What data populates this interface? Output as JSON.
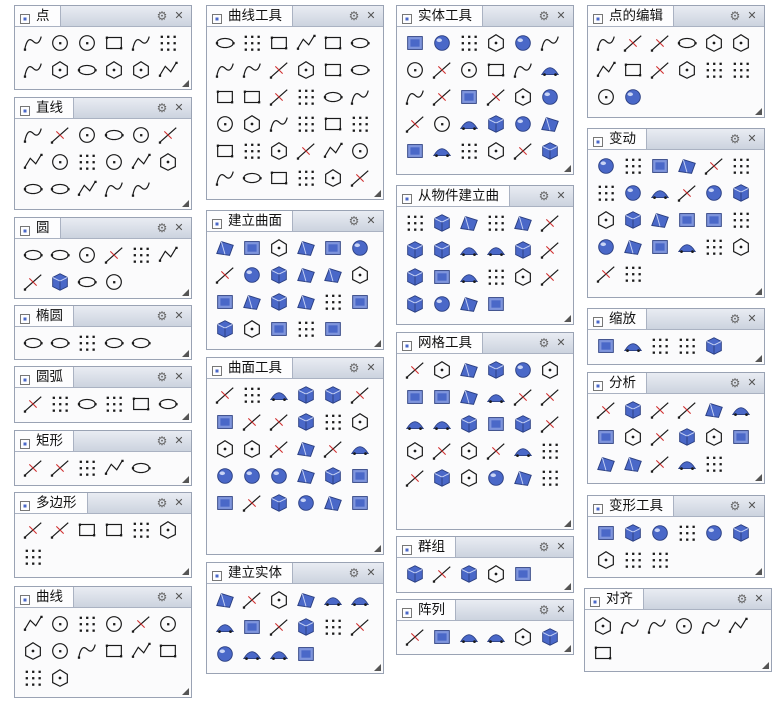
{
  "colors": {
    "panel_bg": "#fbfbfc",
    "titlebar": "#d9dde7",
    "border": "#9aa3b4",
    "icon_blue": "#4a68c8",
    "icon_dark": "#1a1a1a"
  },
  "panels": [
    {
      "id": "point",
      "title": "点",
      "icon": "point-panel-icon",
      "cols": 6,
      "buttons": [
        "single-point",
        "multiple-points",
        "point-cloud",
        "points-on-curve",
        "divide-curve",
        "closest-point",
        "point-grid",
        "points-from-grid",
        "dense-grid",
        "random-points",
        "extract-points",
        "curve-points"
      ]
    },
    {
      "id": "curve-tools",
      "title": "曲线工具",
      "icon": "curve-tools-panel-icon",
      "cols": 6,
      "buttons": [
        "fillet-curve",
        "chamfer-curve",
        "blend-curve",
        "match-curve",
        "offset-curve",
        "extend-curve",
        "control-points-on",
        "curve-edit-point",
        "arc-blend",
        "rebuild-curve",
        "project-curve",
        "dash-curve",
        "fit-curve",
        "rotate-curve",
        "helix",
        "dual-curve",
        "person-edit",
        "person-work",
        "fit-label",
        "deg-label",
        "fair-label",
        "point-array",
        "polygon-edit",
        "insert-knot",
        "crv-a",
        "crv-b",
        "crv-c",
        "crv-d",
        "crv-e",
        "crv-f",
        "crv-g",
        "crv-h",
        "crv-i",
        "crv-j",
        "crv-k",
        "crv-l"
      ]
    },
    {
      "id": "solid-tools",
      "title": "实体工具",
      "icon": "solid-tools-panel-icon",
      "cols": 6,
      "buttons": [
        "boolean-union",
        "boolean-difference",
        "boolean-intersection",
        "boolean-split",
        "cap-holes",
        "extract-surface",
        "fillet-edge",
        "chamfer-edge",
        "shell",
        "extrude-face",
        "move-face",
        "solid-points",
        "move-edge",
        "split-face",
        "box-edit",
        "box-merge",
        "box-face",
        "box-cut",
        "shift-face",
        "merge-face",
        "stack-solids",
        "box-a",
        "box-b",
        "box-c",
        "box-d",
        "box-e",
        "box-f",
        "box-g",
        "box-h",
        "box-i",
        "hole-a",
        "hole-b",
        "hole-c",
        "hole-d",
        "hole-e",
        "hole-f"
      ]
    },
    {
      "id": "point-edit",
      "title": "点的编辑",
      "icon": "point-edit-panel-icon",
      "cols": 6,
      "buttons": [
        "points-on",
        "edit-points",
        "hide-points",
        "insert-point",
        "remove-point",
        "line-point",
        "move-uvn",
        "nudge",
        "smooth-curve",
        "set-pt",
        "drag-points",
        "sphere-pt",
        "green-handle",
        "box-handle"
      ]
    },
    {
      "id": "line",
      "title": "直线",
      "icon": "line-panel-icon",
      "cols": 6,
      "buttons": [
        "line-single",
        "polyline",
        "line-segment",
        "tangent-line",
        "line-angle",
        "line-bisector",
        "line-vertical",
        "line-from-midpoint",
        "line-offset",
        "line-normal",
        "line-perpendicular",
        "line-mid",
        "line-3d",
        "line-dashed",
        "line-polygon",
        "line-pentagon",
        "line-grid-sphere"
      ]
    },
    {
      "id": "circle",
      "title": "圆",
      "icon": "circle-panel-icon",
      "cols": 6,
      "buttons": [
        "circle-center",
        "circle-diameter",
        "circle-3pt",
        "circle-tangent",
        "circle-deformable",
        "circle-basic",
        "circle-tan-a",
        "circle-tan-b",
        "circle-fit",
        "circle-points"
      ]
    },
    {
      "id": "ellipse",
      "title": "椭圆",
      "icon": "ellipse-panel-icon",
      "cols": 6,
      "buttons": [
        "ellipse-center",
        "ellipse-diameter",
        "ellipse-foci",
        "ellipse-corner",
        "ellipse-around"
      ]
    },
    {
      "id": "arc",
      "title": "圆弧",
      "icon": "arc-panel-icon",
      "cols": 6,
      "buttons": [
        "arc-center",
        "arc-3pt",
        "arc-tangent",
        "arc-direction",
        "arc-extend",
        "more-arrows"
      ]
    },
    {
      "id": "rect",
      "title": "矩形",
      "icon": "rect-panel-icon",
      "cols": 6,
      "buttons": [
        "rect-corner",
        "rect-center",
        "rect-3pt",
        "rect-vertical",
        "rect-rounded"
      ]
    },
    {
      "id": "polygon",
      "title": "多边形",
      "icon": "polygon-panel-icon",
      "cols": 6,
      "buttons": [
        "polygon-center",
        "polygon-edge",
        "polygon-star",
        "polygon-sq-a",
        "polygon-sq-b",
        "polygon-sq-c",
        "star-shape"
      ]
    },
    {
      "id": "curve",
      "title": "曲线",
      "icon": "curve-panel-icon",
      "cols": 6,
      "buttons": [
        "curve-control",
        "curve-interp",
        "curve-handle",
        "curve-sketch",
        "curve-conic",
        "curve-helix",
        "curve-spiral",
        "curve-free",
        "curve-corner",
        "curve-blend",
        "curve-freehand",
        "curve-a",
        "curve-b",
        "curve-c"
      ]
    },
    {
      "id": "surface",
      "title": "建立曲面",
      "icon": "surface-panel-icon",
      "cols": 6,
      "buttons": [
        "srf-corner",
        "srf-patch",
        "srf-loft",
        "srf-sweep1",
        "srf-sweep2",
        "srf-network",
        "srf-plane",
        "srf-rect",
        "srf-extrude",
        "srf-revolve",
        "srf-edge",
        "srf-heightfield",
        "srf-cylinder",
        "srf-bulge",
        "srf-cone",
        "srf-tilt",
        "srf-cut",
        "srf-point",
        "srf-rail-1-2",
        "srf-fold",
        "srf-drape",
        "srf-heat",
        "srf-grid"
      ]
    },
    {
      "id": "from-object",
      "title": "从物件建立曲",
      "icon": "from-object-panel-icon",
      "cols": 6,
      "buttons": [
        "obj-contour",
        "obj-section",
        "obj-intersect",
        "obj-silhouette",
        "obj-wire",
        "obj-dup-border",
        "obj-dup-edge",
        "obj-offset",
        "obj-project",
        "obj-extract",
        "obj-dup-mesh",
        "obj-dots",
        "obj-points",
        "obj-unroll",
        "obj-a",
        "obj-b",
        "obj-c",
        "obj-d",
        "obj-e",
        "obj-f",
        "obj-g",
        "obj-h"
      ]
    },
    {
      "id": "transform",
      "title": "变动",
      "icon": "transform-panel-icon",
      "cols": 6,
      "buttons": [
        "tr-move",
        "tr-copy",
        "tr-rotate",
        "tr-scale",
        "tr-mirror",
        "tr-orient",
        "tr-align",
        "tr-array",
        "tr-arrange",
        "tr-twist",
        "tr-bend",
        "tr-taper",
        "tr-flow",
        "tr-splop",
        "tr-array-polar",
        "tr-array-curve",
        "tr-array-srf",
        "tr-person",
        "tr-a",
        "tr-b",
        "tr-c",
        "tr-d",
        "tr-e",
        "tr-f",
        "tr-g",
        "tr-red-arrow"
      ]
    },
    {
      "id": "surface-tools",
      "title": "曲面工具",
      "icon": "surface-tools-panel-icon",
      "cols": 6,
      "buttons": [
        "st-fillet",
        "st-chamfer",
        "st-blend",
        "st-match",
        "st-offset",
        "st-extend",
        "st-merge",
        "st-join",
        "st-trim",
        "st-untrim",
        "st-split",
        "st-rebuild",
        "st-shrink",
        "st-edge-a",
        "st-edge-b",
        "st-person",
        "st-person-b",
        "st-fit",
        "st-deg",
        "st-fair",
        "st-pt",
        "st-edge",
        "st-edge-c",
        "st-flow",
        "st-x",
        "st-x2",
        "st-x3",
        "st-x4",
        "st-x5",
        "st-x6"
      ]
    },
    {
      "id": "mesh-tools",
      "title": "网格工具",
      "icon": "mesh-tools-panel-icon",
      "cols": 6,
      "buttons": [
        "mesh-check",
        "mesh-repair",
        "mesh-box",
        "mesh-red",
        "mesh-split",
        "mesh-person",
        "mesh-person-b",
        "mesh-bucket",
        "mesh-flat",
        "mesh-skull",
        "mesh-grid",
        "mesh-weld",
        "mesh-offset",
        "mesh-fill",
        "mesh-gear",
        "mesh-triangulate",
        "mesh-quad",
        "mesh-stack",
        "mesh-sphere",
        "mesh-patch",
        "mesh-edge",
        "mesh-reduce",
        "mesh-stack-b",
        "mesh-stack-c",
        "mesh-box-b",
        "mesh-box-c",
        "mesh-stack-d",
        "mesh-box-d",
        "mesh-box-e",
        "mesh-num"
      ]
    },
    {
      "id": "scale",
      "title": "缩放",
      "icon": "scale-panel-icon",
      "cols": 6,
      "buttons": [
        "scale-3d",
        "scale-2d",
        "scale-1d",
        "scale-nonuni",
        "scale-grid"
      ]
    },
    {
      "id": "analyze",
      "title": "分析",
      "icon": "analyze-panel-icon",
      "cols": 6,
      "buttons": [
        "an-length",
        "an-xyz",
        "an-dist",
        "an-point",
        "an-angle",
        "an-vector",
        "an-radius",
        "an-tilt",
        "an-smooth",
        "an-c2",
        "an-edge",
        "an-plane",
        "an-color",
        "an-box",
        "an-check",
        "an-skull",
        "an-num"
      ]
    },
    {
      "id": "group",
      "title": "群组",
      "icon": "group-panel-icon",
      "cols": 6,
      "buttons": [
        "group",
        "ungroup",
        "add-to-group",
        "remove-from-group",
        "set-group-name"
      ]
    },
    {
      "id": "array",
      "title": "阵列",
      "icon": "array-panel-icon",
      "cols": 6,
      "buttons": [
        "array-rect",
        "array-polar",
        "array-curve",
        "array-srf",
        "array-crv-srf",
        "array-linear"
      ]
    },
    {
      "id": "solid-create",
      "title": "建立实体",
      "icon": "solid-create-panel-icon",
      "cols": 6,
      "buttons": [
        "solid-box",
        "solid-cylinder",
        "solid-sphere",
        "solid-ellipsoid",
        "solid-paraboloid",
        "solid-torus",
        "solid-cone",
        "solid-truncated-cone",
        "solid-pyramid",
        "solid-truncated-pyramid",
        "solid-tube",
        "solid-pipe",
        "solid-torus-b",
        "solid-pipe-b",
        "solid-extrude",
        "solid-slab"
      ]
    },
    {
      "id": "deform",
      "title": "变形工具",
      "icon": "deform-panel-icon",
      "cols": 6,
      "buttons": [
        "def-cage",
        "def-twist",
        "def-splop",
        "def-flow",
        "def-taper",
        "def-bend",
        "def-stretch",
        "def-maelstrom",
        "def-smooth"
      ]
    },
    {
      "id": "align",
      "title": "对齐",
      "icon": "align-panel-icon",
      "cols": 6,
      "buttons": [
        "al-bottom",
        "al-top",
        "al-left",
        "al-right",
        "al-hcenter",
        "al-vcenter",
        "al-both"
      ]
    }
  ]
}
